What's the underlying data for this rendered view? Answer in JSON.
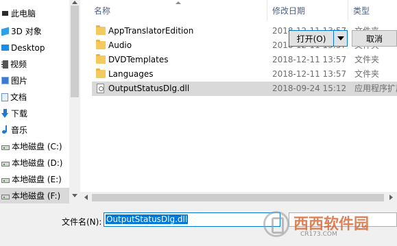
{
  "nav": {
    "items": [
      {
        "label": "此电脑",
        "icon": "computer-icon"
      },
      {
        "label": "3D 对象",
        "icon": "3d-objects-icon"
      },
      {
        "label": "Desktop",
        "icon": "desktop-icon"
      },
      {
        "label": "视频",
        "icon": "video-icon"
      },
      {
        "label": "图片",
        "icon": "pictures-icon"
      },
      {
        "label": "文档",
        "icon": "documents-icon"
      },
      {
        "label": "下载",
        "icon": "downloads-icon"
      },
      {
        "label": "音乐",
        "icon": "music-icon"
      },
      {
        "label": "本地磁盘 (C:)",
        "icon": "drive-icon"
      },
      {
        "label": "本地磁盘 (D:)",
        "icon": "drive-icon"
      },
      {
        "label": "本地磁盘 (E:)",
        "icon": "drive-icon"
      },
      {
        "label": "本地磁盘 (F:)",
        "icon": "drive-icon",
        "selected": true
      }
    ]
  },
  "list": {
    "columns": {
      "name": "名称",
      "date": "修改日期",
      "type": "类型"
    },
    "rows": [
      {
        "name": "AppTranslatorEdition",
        "date": "2018-12-11 13:57",
        "type": "文件夹",
        "kind": "folder"
      },
      {
        "name": "Audio",
        "date": "2018-12-11 13:57",
        "type": "文件夹",
        "kind": "folder"
      },
      {
        "name": "DVDTemplates",
        "date": "2018-12-11 13:57",
        "type": "文件夹",
        "kind": "folder"
      },
      {
        "name": "Languages",
        "date": "2018-12-11 13:57",
        "type": "文件夹",
        "kind": "folder"
      },
      {
        "name": "OutputStatusDlg.dll",
        "date": "2018-09-24 15:12",
        "type": "应用程序扩展",
        "kind": "file",
        "selected": true
      }
    ]
  },
  "bottom": {
    "filename_label": "文件名(N):",
    "filename_value": "OutputStatusDlg.dll",
    "open_label": "打开(O)",
    "cancel_label": "取消"
  },
  "watermark": {
    "title": "西西软件园",
    "url": "CR173.COM"
  },
  "colors": {
    "accent": "#0078d7",
    "selection": "#d9d9d9",
    "folder": "#f4c95d",
    "header_text": "#4d6185"
  }
}
